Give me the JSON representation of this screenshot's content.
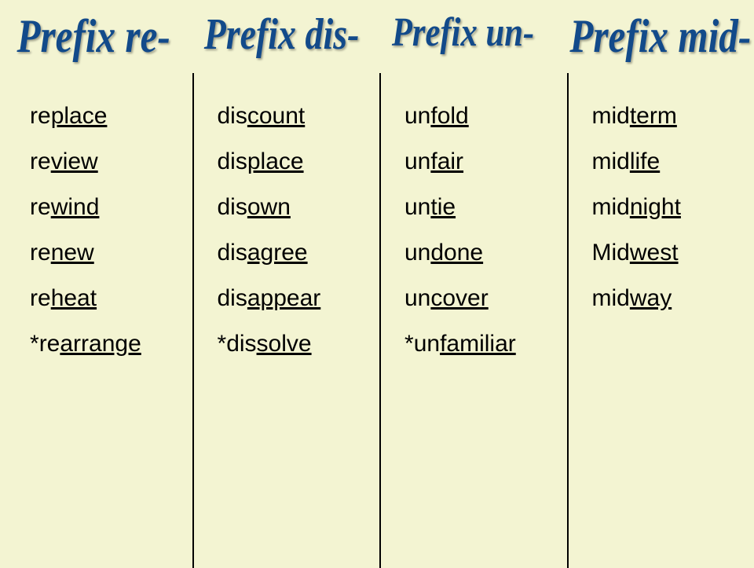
{
  "columns": [
    {
      "header": "Prefix re-",
      "words": [
        {
          "prefix": "re",
          "root": "place",
          "starred": false
        },
        {
          "prefix": "re",
          "root": "view",
          "starred": false
        },
        {
          "prefix": "re",
          "root": "wind",
          "starred": false
        },
        {
          "prefix": "re",
          "root": "new",
          "starred": false
        },
        {
          "prefix": "re",
          "root": "heat",
          "starred": false
        },
        {
          "prefix": "re",
          "root": "arrange",
          "starred": true
        }
      ]
    },
    {
      "header": "Prefix dis-",
      "words": [
        {
          "prefix": "dis",
          "root": "count",
          "starred": false
        },
        {
          "prefix": "dis",
          "root": "place",
          "starred": false
        },
        {
          "prefix": "dis",
          "root": "own",
          "starred": false
        },
        {
          "prefix": "dis",
          "root": "agree",
          "starred": false
        },
        {
          "prefix": "dis",
          "root": "appear",
          "starred": false
        },
        {
          "prefix": "dis",
          "root": "solve",
          "starred": true
        }
      ]
    },
    {
      "header": "Prefix un-",
      "words": [
        {
          "prefix": "un",
          "root": "fold",
          "starred": false
        },
        {
          "prefix": "un",
          "root": "fair",
          "starred": false
        },
        {
          "prefix": "un",
          "root": "tie",
          "starred": false
        },
        {
          "prefix": "un",
          "root": "done",
          "starred": false
        },
        {
          "prefix": "un",
          "root": "cover",
          "starred": false
        },
        {
          "prefix": "un",
          "root": "familiar",
          "starred": true
        }
      ]
    },
    {
      "header": "Prefix mid-",
      "words": [
        {
          "prefix": "mid",
          "root": "term",
          "starred": false
        },
        {
          "prefix": "mid",
          "root": "life",
          "starred": false
        },
        {
          "prefix": "mid",
          "root": "night",
          "starred": false
        },
        {
          "prefix": "Mid",
          "root": "west",
          "starred": false
        },
        {
          "prefix": "mid",
          "root": "way",
          "starred": false
        }
      ]
    }
  ]
}
